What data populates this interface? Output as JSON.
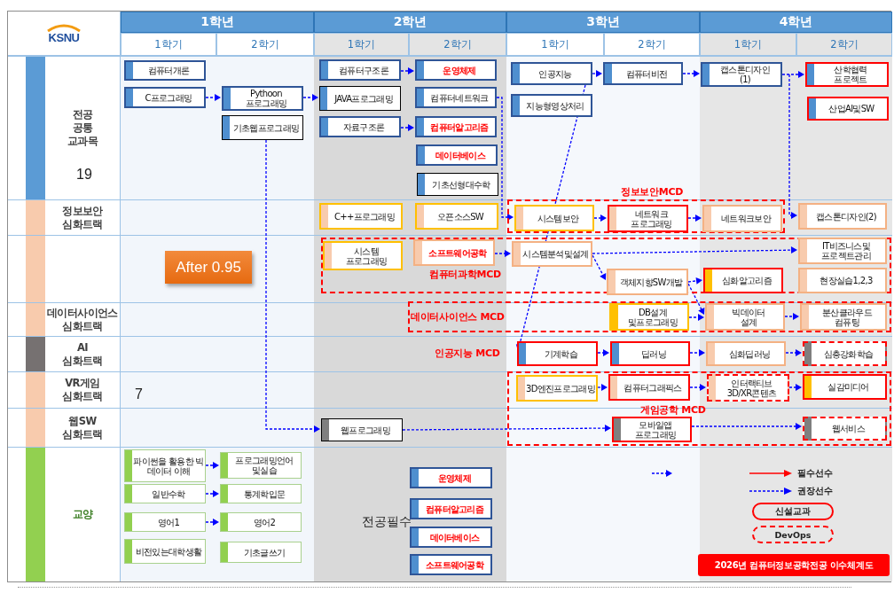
{
  "logo": {
    "text": "KSNU"
  },
  "years": [
    {
      "label": "1학년",
      "terms": [
        "1학기",
        "2학기"
      ]
    },
    {
      "label": "2학년",
      "terms": [
        "1학기",
        "2학기"
      ]
    },
    {
      "label": "3학년",
      "terms": [
        "1학기",
        "2학기"
      ]
    },
    {
      "label": "4학년",
      "terms": [
        "1학기",
        "2학기"
      ]
    }
  ],
  "tracks": [
    {
      "lines": [
        "전공",
        "공통",
        "교과목"
      ],
      "color": "#5b9bd5",
      "count": "19",
      "courses": [
        {
          "name": "컴퓨터개론",
          "kind": "core",
          "required": false
        },
        {
          "name": "C프로그래밍",
          "kind": "core",
          "required": false
        },
        {
          "name": "Pythoon\n프로그래밍",
          "kind": "core",
          "required": false
        },
        {
          "name": "기초웹프로그래밍",
          "kind": "base",
          "required": false
        },
        {
          "name": "컴퓨터구조론",
          "kind": "core",
          "required": false
        },
        {
          "name": "JAVA프로그래밍",
          "kind": "base",
          "required": false
        },
        {
          "name": "자료구조론",
          "kind": "core",
          "required": false
        },
        {
          "name": "운영체제",
          "kind": "core",
          "required": true
        },
        {
          "name": "컴퓨터네트워크",
          "kind": "core",
          "required": false
        },
        {
          "name": "컴퓨터알고리즘",
          "kind": "core",
          "required": true
        },
        {
          "name": "데이터베이스",
          "kind": "core",
          "required": true
        },
        {
          "name": "기초선형대수학",
          "kind": "base",
          "required": false
        },
        {
          "name": "인공지능",
          "kind": "core",
          "required": false
        },
        {
          "name": "지능형영상처리",
          "kind": "core",
          "required": false
        },
        {
          "name": "컴퓨터비전",
          "kind": "core",
          "required": false
        },
        {
          "name": "캡스톤디자인\n(1)",
          "kind": "core",
          "required": false
        },
        {
          "name": "산학협력\n프로젝트",
          "kind": "corenew",
          "required": false
        },
        {
          "name": "산업AI및SW",
          "kind": "corenew",
          "required": false
        }
      ]
    },
    {
      "lines": [
        "정보보안",
        "심화트랙"
      ],
      "color": "#f8cbad",
      "mcd": {
        "label": "정보보안MCD"
      },
      "courses": [
        {
          "name": "C++프로그래밍",
          "kind": "track",
          "required": false
        },
        {
          "name": "오픈소스SW",
          "kind": "track",
          "required": false
        },
        {
          "name": "시스템보안",
          "kind": "track",
          "required": false
        },
        {
          "name": "네트워크\n프로그래밍",
          "kind": "tracknew",
          "required": false
        },
        {
          "name": "네트워크보안",
          "kind": "tracksoft",
          "required": false
        },
        {
          "name": "캡스톤디자인(2)",
          "kind": "tracksoft",
          "required": false
        }
      ]
    },
    {
      "color": "#f8cbad",
      "mcd": {
        "label": "컴퓨터과학MCD"
      },
      "courses": [
        {
          "name": "시스템\n프로그래밍",
          "kind": "track",
          "required": false
        },
        {
          "name": "소프트웨어공학",
          "kind": "tracksoft",
          "required": true
        },
        {
          "name": "시스템분석및설계",
          "kind": "tracksoft",
          "required": false
        },
        {
          "name": "객체지향SW개발",
          "kind": "tracksoft",
          "required": false
        },
        {
          "name": "심화알고리즘",
          "kind": "electivenew",
          "required": false
        },
        {
          "name": "IT비즈니스및\n프로젝트관리",
          "kind": "tracksoft",
          "required": false
        },
        {
          "name": "현장실습1,2,3",
          "kind": "tracksoft",
          "required": false
        }
      ]
    },
    {
      "lines": [
        "데이터사이언스",
        "심화트랙"
      ],
      "color": "#f8cbad",
      "mcd": {
        "label": "데이터사이언스 MCD"
      },
      "courses": [
        {
          "name": "DB설계\n및프로그래밍",
          "kind": "elective",
          "required": false
        },
        {
          "name": "빅데이터\n설계",
          "kind": "tracksoft",
          "required": false
        },
        {
          "name": "분산클라우드\n컴퓨팅",
          "kind": "tracksoft",
          "required": false
        }
      ]
    },
    {
      "lines": [
        "AI",
        "심화트랙"
      ],
      "color": "#767171",
      "mcd": {
        "label": "인공지능 MCD"
      },
      "courses": [
        {
          "name": "기계학습",
          "kind": "corenew",
          "required": false
        },
        {
          "name": "딥러닝",
          "kind": "corenew",
          "required": false
        },
        {
          "name": "심화딥러닝",
          "kind": "tracksoft",
          "required": false
        },
        {
          "name": "심층강화학습",
          "kind": "webdevops",
          "required": false
        }
      ]
    },
    {
      "lines": [
        "VR게임",
        "심화트랙"
      ],
      "color": "#f8cbad",
      "count": "7",
      "mcd": {
        "label": "게임공학 MCD"
      },
      "courses": [
        {
          "name": "3D엔진프로그래밍",
          "kind": "track",
          "required": false
        },
        {
          "name": "컴퓨터그래픽스",
          "kind": "tracknew",
          "required": false
        },
        {
          "name": "인터랙티브\n3D/XR콘텐츠",
          "kind": "trackdevops",
          "required": false
        },
        {
          "name": "실감미디어",
          "kind": "electivenew",
          "required": false
        }
      ]
    },
    {
      "lines": [
        "웹SW",
        "심화트랙"
      ],
      "color": "#f8cbad",
      "courses": [
        {
          "name": "웹프로그래밍",
          "kind": "web",
          "required": false
        },
        {
          "name": "모바일앱\n프로그래밍",
          "kind": "webnew",
          "required": false
        },
        {
          "name": "웹서비스",
          "kind": "webdevops",
          "required": false
        }
      ]
    },
    {
      "lines": [
        "교양"
      ],
      "color": "#92d050",
      "courses": [
        {
          "name": "파이썬을 활용한 빅데이터 이해",
          "kind": "liberal",
          "required": false
        },
        {
          "name": "프로그래밍언어\n및실습",
          "kind": "liberal",
          "required": false
        },
        {
          "name": "일반수학",
          "kind": "liberal",
          "required": false
        },
        {
          "name": "통계학입문",
          "kind": "liberal",
          "required": false
        },
        {
          "name": "영어1",
          "kind": "liberal",
          "required": false
        },
        {
          "name": "영어2",
          "kind": "liberal",
          "required": false
        },
        {
          "name": "비전있는대학생활",
          "kind": "liberal",
          "required": false
        },
        {
          "name": "기초글쓰기",
          "kind": "liberal",
          "required": false
        }
      ]
    }
  ],
  "badge": {
    "text": "After 0.95"
  },
  "required_list": {
    "title": "전공필수",
    "courses": [
      {
        "name": "운영체제",
        "kind": "core",
        "required": true
      },
      {
        "name": "컴퓨터알고리즘",
        "kind": "core",
        "required": true
      },
      {
        "name": "데이터베이스",
        "kind": "core",
        "required": true
      },
      {
        "name": "소프트웨어공학",
        "kind": "core",
        "required": true
      }
    ]
  },
  "legend": [
    {
      "kind": "required",
      "label": "필수선수"
    },
    {
      "kind": "recommended",
      "label": "권장선수"
    },
    {
      "kind": "new",
      "label": "신설교과"
    },
    {
      "kind": "devops",
      "label": "DevOps"
    }
  ],
  "title": "2026년 컴퓨터정보공학전공 이수체계도"
}
